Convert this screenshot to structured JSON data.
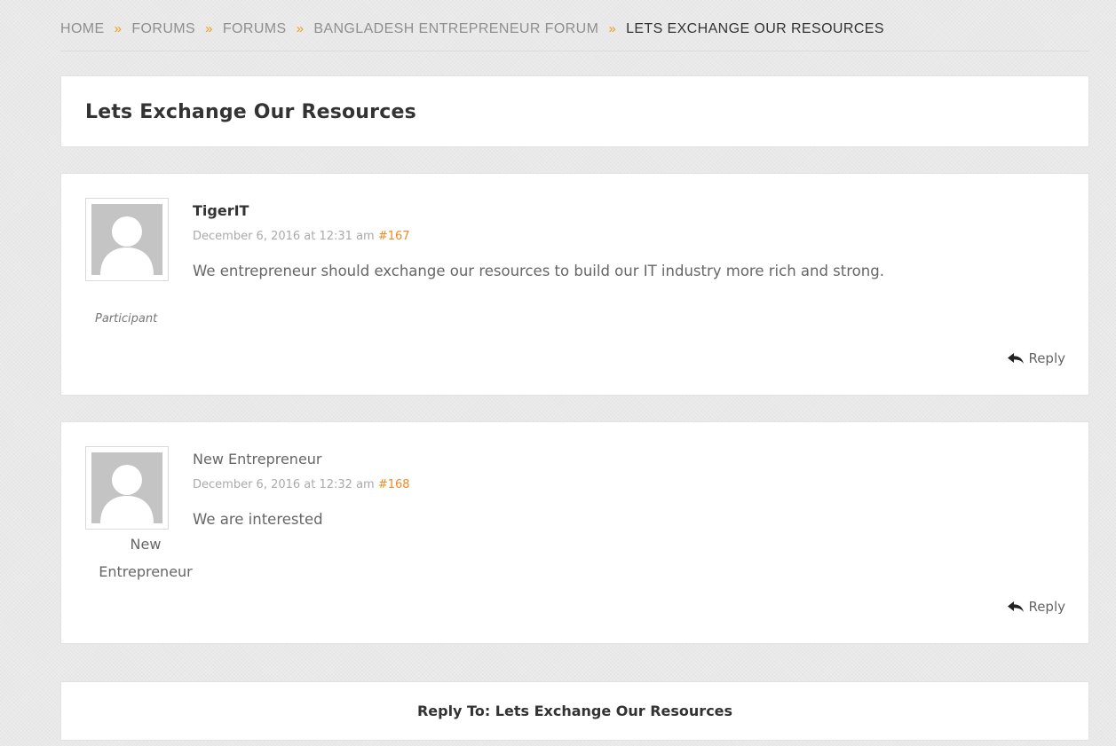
{
  "breadcrumb": {
    "items": [
      "HOME",
      "FORUMS",
      "FORUMS",
      "BANGLADESH ENTREPRENEUR FORUM"
    ],
    "current": "LETS EXCHANGE OUR RESOURCES",
    "separator": "»"
  },
  "topic": {
    "title": "Lets Exchange Our Resources"
  },
  "posts": [
    {
      "author": "TigerIT",
      "date": "December 6, 2016 at 12:31 am",
      "id": "#167",
      "content": "We entrepreneur should exchange our resources to build our IT industry more rich and strong.",
      "role": "Participant",
      "reply_label": "Reply"
    },
    {
      "author": "New Entrepreneur",
      "date": "December 6, 2016 at 12:32 am",
      "id": "#168",
      "content": "We are interested",
      "author_line1": "New",
      "author_line2": "Entrepreneur",
      "reply_label": "Reply"
    }
  ],
  "reply_form": {
    "title": "Reply To: Lets Exchange Our Resources"
  },
  "colors": {
    "accent": "#f08a24",
    "separator": "#f39c12",
    "background": "#ececec"
  },
  "icons": {
    "avatar": "default-avatar-icon",
    "reply": "reply-arrow-icon",
    "separator": "double-chevron-right-icon"
  }
}
